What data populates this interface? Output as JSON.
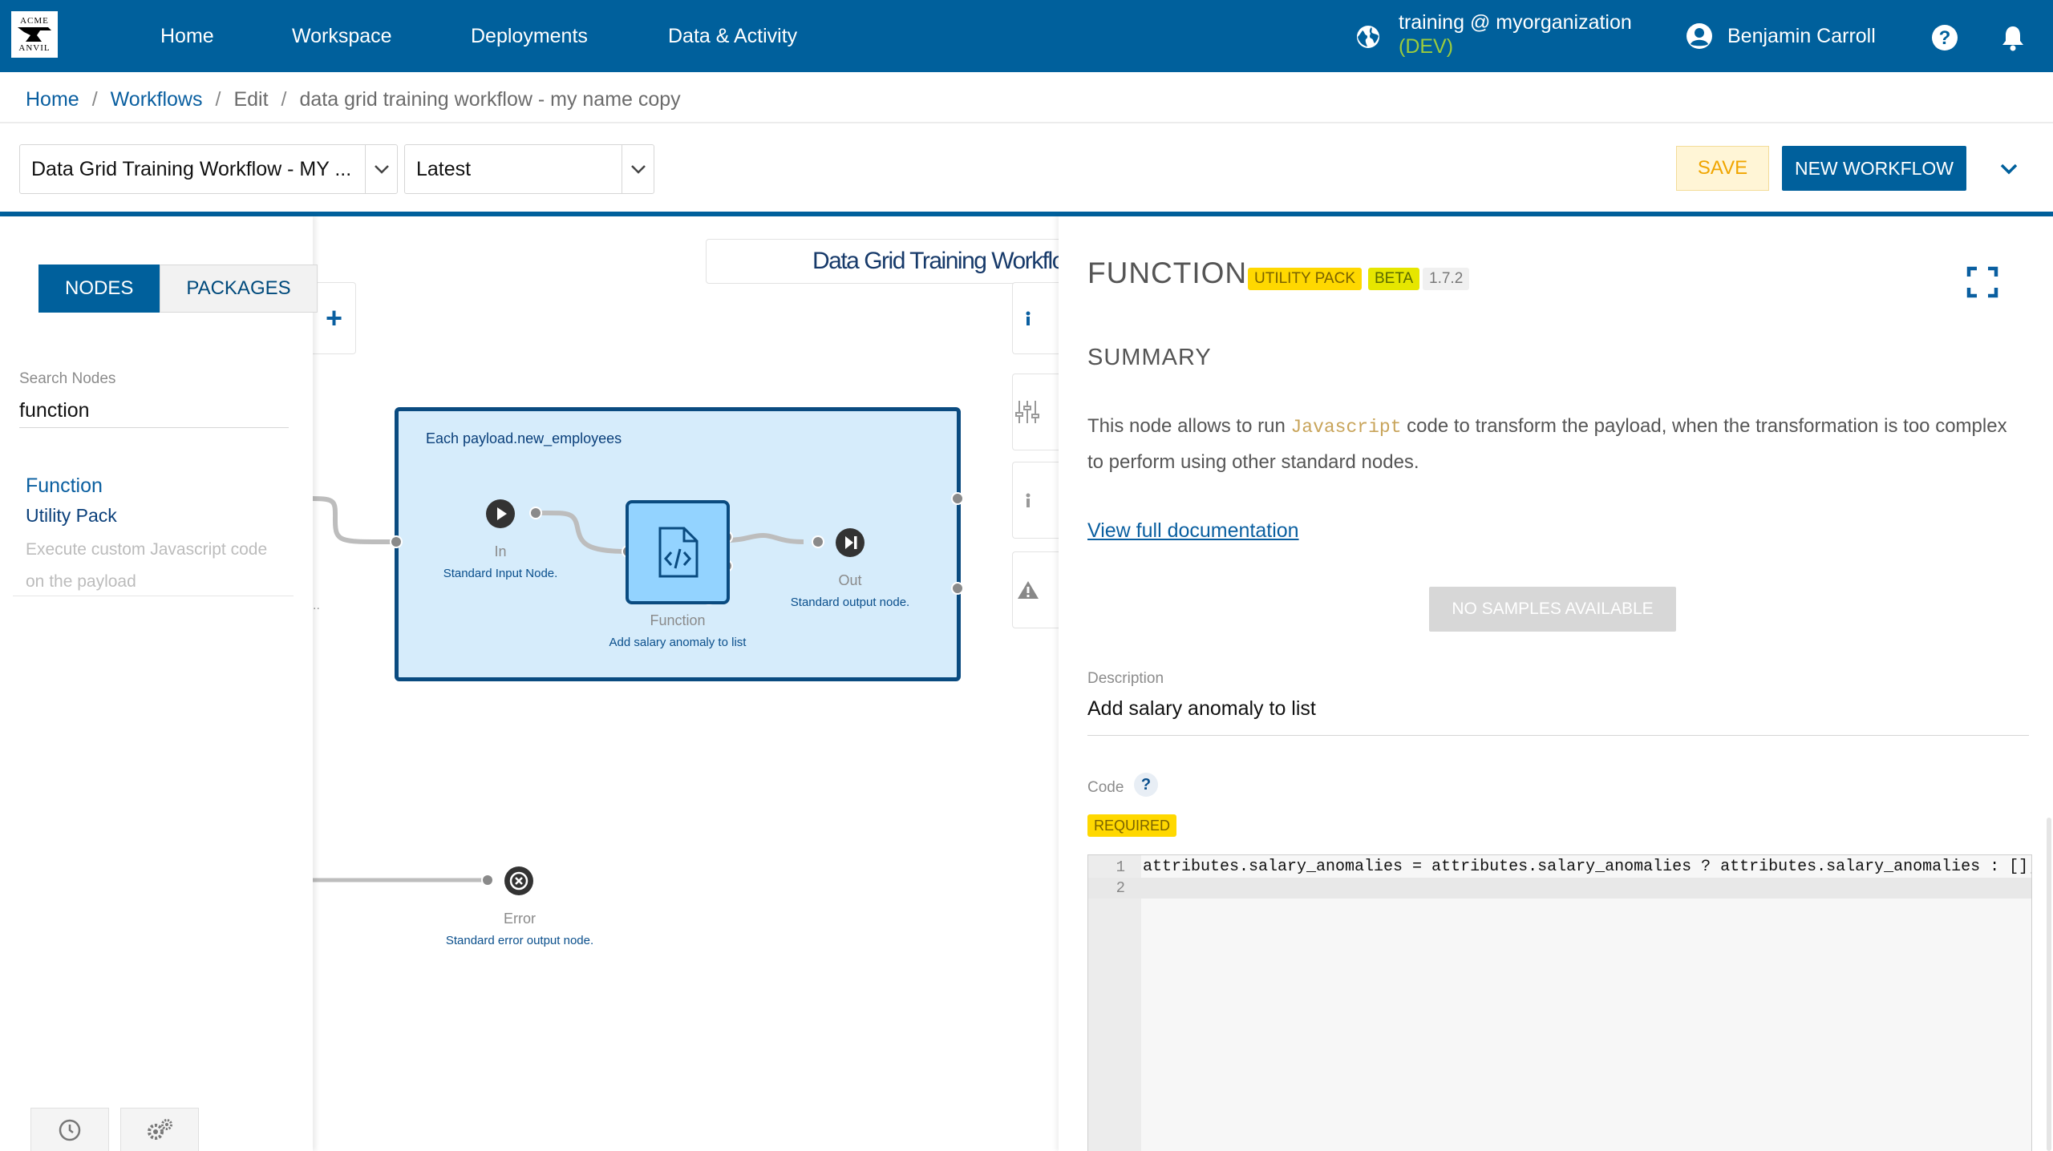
{
  "app": {
    "logo_line1": "ACME",
    "logo_line2": "ANVIL",
    "accent": "#00609c"
  },
  "nav": {
    "items": [
      "Home",
      "Workspace",
      "Deployments",
      "Data & Activity"
    ],
    "org_name": "training @ myorganization",
    "org_env": "(DEV)",
    "user_name": "Benjamin Carroll"
  },
  "breadcrumb": {
    "home": "Home",
    "workflows": "Workflows",
    "edit": "Edit",
    "current": "data grid training workflow - my name copy"
  },
  "toolbar": {
    "workflow_select": "Data Grid Training Workflow - MY ...",
    "version_select": "Latest",
    "save_label": "SAVE",
    "new_workflow_label": "NEW WORKFLOW"
  },
  "left_panel": {
    "tabs": [
      "NODES",
      "PACKAGES"
    ],
    "search_label": "Search Nodes",
    "search_value": "function",
    "result": {
      "title": "Function",
      "package": "Utility Pack",
      "description": "Execute custom Javascript code on the payload"
    }
  },
  "canvas": {
    "title": "Data Grid Training Workflow",
    "group_label": "Each payload.new_employees",
    "nodes": {
      "in": {
        "name": "In",
        "desc": "Standard Input Node."
      },
      "function": {
        "name": "Function",
        "desc": "Add salary anomaly to list"
      },
      "out": {
        "name": "Out",
        "desc": "Standard output node."
      },
      "error": {
        "name": "Error",
        "desc": "Standard error output node."
      }
    }
  },
  "right_panel": {
    "title": "FUNCTION",
    "badge_pack": "UTILITY PACK",
    "badge_beta": "BETA",
    "version": "1.7.2",
    "summary_heading": "SUMMARY",
    "summary_pre": "This node allows to run ",
    "summary_code": "Javascript",
    "summary_post": " code to transform the payload, when the transformation is too complex to perform using other standard nodes.",
    "doc_link": "View full documentation",
    "no_samples": "NO SAMPLES AVAILABLE",
    "description_label": "Description",
    "description_value": "Add salary anomaly to list",
    "code_label": "Code",
    "code_help": "?",
    "required_badge": "REQUIRED",
    "code_lines": [
      "attributes.salary_anomalies = attributes.salary_anomalies ? attributes.salary_anomalies : [];",
      ""
    ],
    "line_numbers": [
      "1",
      "2"
    ]
  }
}
